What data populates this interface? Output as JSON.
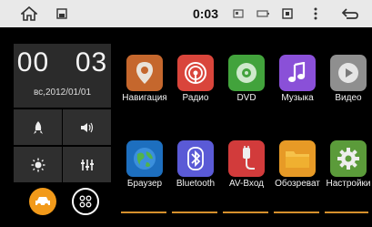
{
  "statusbar": {
    "time": "0:03",
    "icons": [
      "home-icon",
      "screen-icon",
      "sd-card-icon",
      "battery-icon",
      "media-icon",
      "more-vert-icon",
      "back-icon"
    ]
  },
  "clock": {
    "hours": "00",
    "minutes": "03",
    "date": "вс,2012/01/01"
  },
  "quick_controls": [
    {
      "icon": "rocket-icon"
    },
    {
      "icon": "volume-icon"
    },
    {
      "icon": "brightness-icon"
    },
    {
      "icon": "equalizer-icon"
    }
  ],
  "bottom_buttons": [
    {
      "icon": "car-icon",
      "color": "#f29a1a"
    },
    {
      "icon": "apps-grid-icon",
      "color": "#ffffff"
    }
  ],
  "apps": [
    {
      "label": "Навигация",
      "icon": "navigation-pin-icon",
      "color": "#c5672d"
    },
    {
      "label": "Радио",
      "icon": "radio-icon",
      "color": "#d9453b"
    },
    {
      "label": "DVD",
      "icon": "disc-icon",
      "color": "#42a33c"
    },
    {
      "label": "Музыка",
      "icon": "music-note-icon",
      "color": "#8a50d8"
    },
    {
      "label": "Видео",
      "icon": "play-icon",
      "color": "#8f8f8f"
    },
    {
      "label": "Браузер",
      "icon": "globe-icon",
      "color": "#1d6fbf"
    },
    {
      "label": "Bluetooth",
      "icon": "bluetooth-icon",
      "color": "#5a5ad6"
    },
    {
      "label": "AV-Вход",
      "icon": "av-plug-icon",
      "color": "#d23b3b"
    },
    {
      "label": "Обозреват",
      "icon": "folder-icon",
      "color": "#e79a26"
    },
    {
      "label": "Настройки",
      "icon": "settings-icon",
      "color": "#5b9b3a"
    }
  ],
  "accent_color": "#d6902c"
}
